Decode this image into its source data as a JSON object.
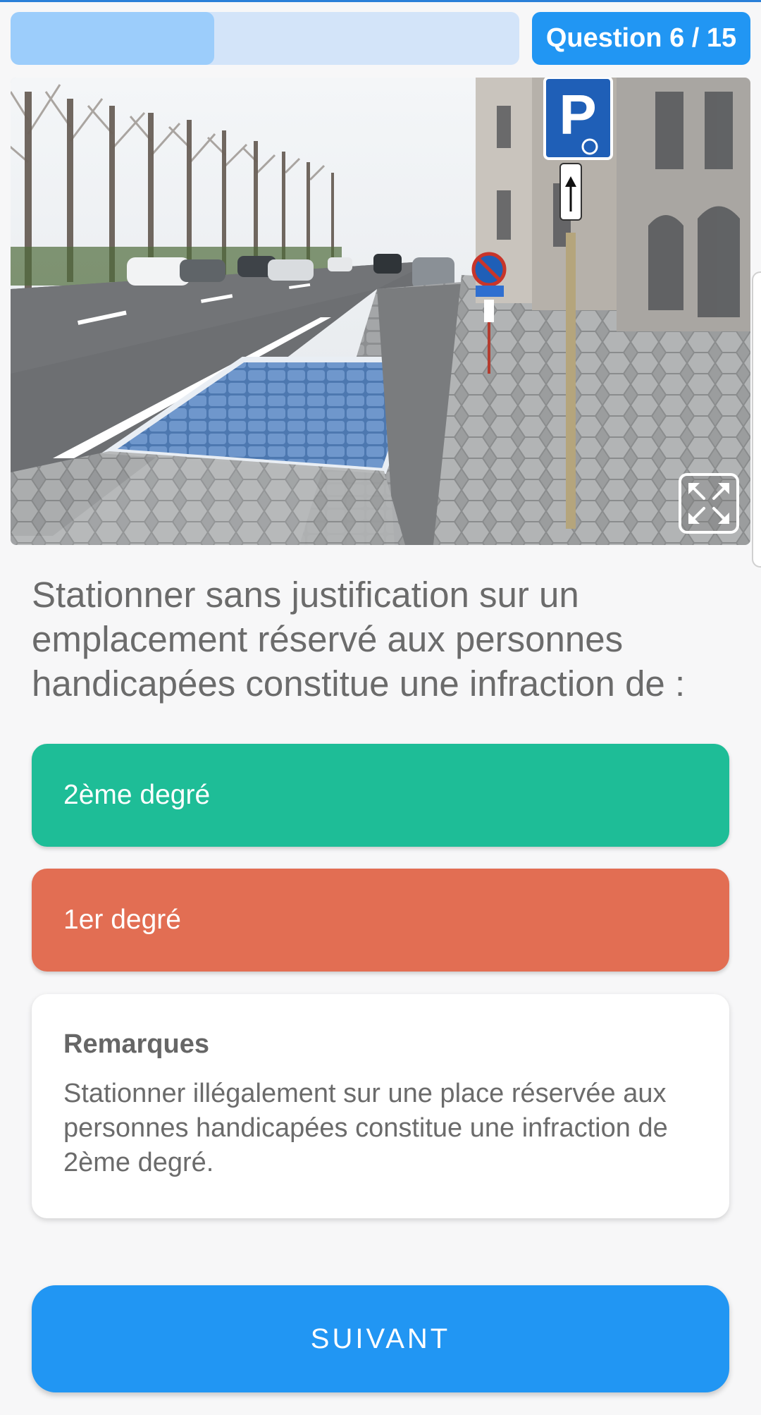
{
  "header": {
    "progress": 0.4,
    "question_counter": "Question 6 / 15"
  },
  "image": {
    "content": "street-photo-disabled-parking",
    "expand_icon": "expand-arrows-icon"
  },
  "question": {
    "text": "Stationner sans justification sur un emplacement réservé aux personnes handicapées constitue une infraction de :"
  },
  "answers": [
    {
      "label": "2ème degré",
      "state": "correct",
      "color": "#1ebd97"
    },
    {
      "label": "1er degré",
      "state": "wrong",
      "color": "#e26e53"
    }
  ],
  "remarks": {
    "title": "Remarques",
    "body": "Stationner illégalement sur une place réservée aux personnes handicapées constitue une infraction de 2ème degré."
  },
  "next_button": {
    "label": "SUIVANT",
    "color": "#2196f3"
  }
}
